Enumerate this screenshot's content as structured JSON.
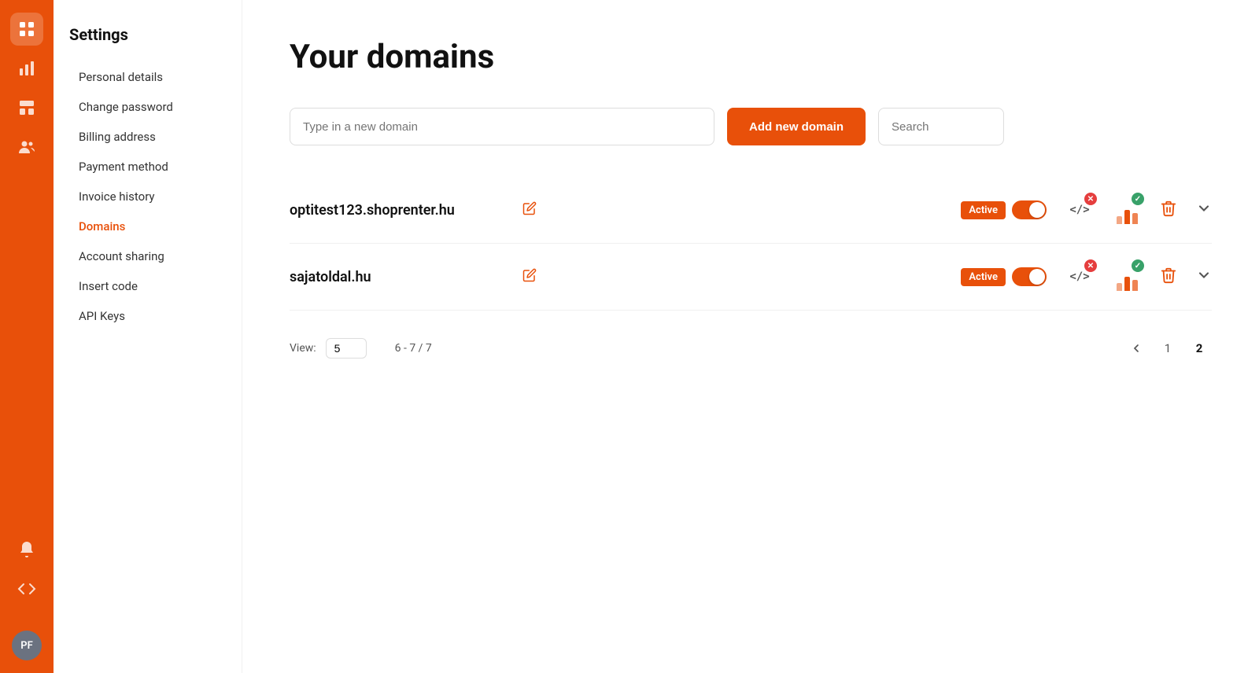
{
  "navIcons": [
    {
      "name": "grid-icon",
      "symbol": "⊞",
      "active": true
    },
    {
      "name": "chart-icon",
      "symbol": "📊",
      "active": false
    },
    {
      "name": "layout-icon",
      "symbol": "⊡",
      "active": false
    },
    {
      "name": "users-icon",
      "symbol": "👤",
      "active": false
    }
  ],
  "navBottom": [
    {
      "name": "bell-icon",
      "symbol": "🔔"
    },
    {
      "name": "code-icon",
      "symbol": "</>"
    }
  ],
  "avatar": {
    "initials": "PF"
  },
  "sidebar": {
    "title": "Settings",
    "items": [
      {
        "label": "Personal details",
        "name": "personal-details",
        "active": false
      },
      {
        "label": "Change password",
        "name": "change-password",
        "active": false
      },
      {
        "label": "Billing address",
        "name": "billing-address",
        "active": false
      },
      {
        "label": "Payment method",
        "name": "payment-method",
        "active": false
      },
      {
        "label": "Invoice history",
        "name": "invoice-history",
        "active": false
      },
      {
        "label": "Domains",
        "name": "domains",
        "active": true
      },
      {
        "label": "Account sharing",
        "name": "account-sharing",
        "active": false
      },
      {
        "label": "Insert code",
        "name": "insert-code",
        "active": false
      },
      {
        "label": "API Keys",
        "name": "api-keys",
        "active": false
      }
    ]
  },
  "page": {
    "title": "Your domains",
    "inputPlaceholder": "Type in a new domain",
    "addButtonLabel": "Add new domain",
    "searchPlaceholder": "Search"
  },
  "domains": [
    {
      "id": "domain-1",
      "name": "optitest123.shoprenter.hu",
      "status": "Active",
      "toggleOn": true
    },
    {
      "id": "domain-2",
      "name": "sajatoldal.hu",
      "status": "Active",
      "toggleOn": true
    }
  ],
  "pagination": {
    "viewLabel": "View:",
    "viewValue": "5",
    "rangeLabel": "6 - 7 / 7",
    "pages": [
      "1",
      "2"
    ],
    "currentPage": "2",
    "prevArrow": "‹",
    "nextArrow": "›"
  }
}
